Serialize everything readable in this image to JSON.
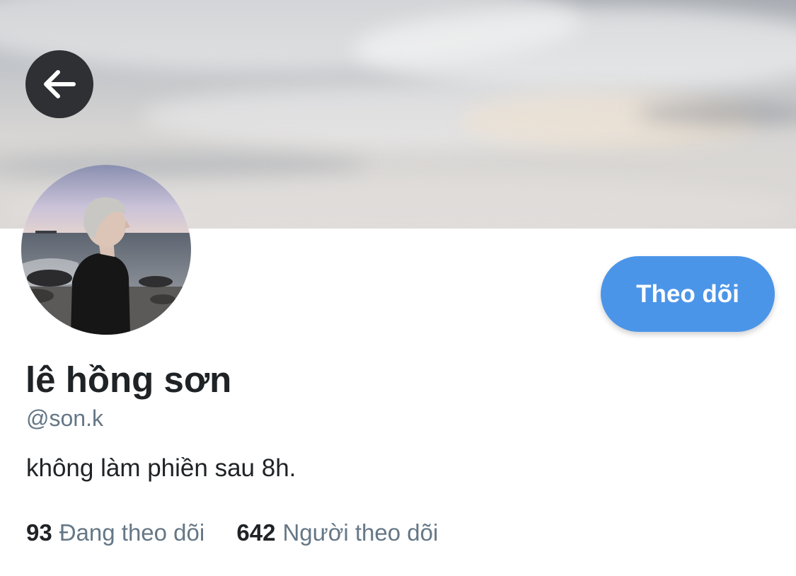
{
  "header": {
    "banner_image": "cloudy-sky-banner",
    "back_icon": "arrow-left-icon"
  },
  "profile": {
    "avatar_image": "profile-avatar-photo",
    "display_name": "lê hồng sơn",
    "handle": "@son.k",
    "bio": "không làm phiền sau 8h.",
    "follow_button_label": "Theo dõi",
    "stats": [
      {
        "count": "93",
        "label": "Đang theo dõi"
      },
      {
        "count": "642",
        "label": "Người theo dõi"
      }
    ]
  },
  "colors": {
    "accent": "#4b95e8",
    "text_primary": "#1f2326",
    "text_secondary": "#657786",
    "back_button_bg": "#2f3033"
  }
}
